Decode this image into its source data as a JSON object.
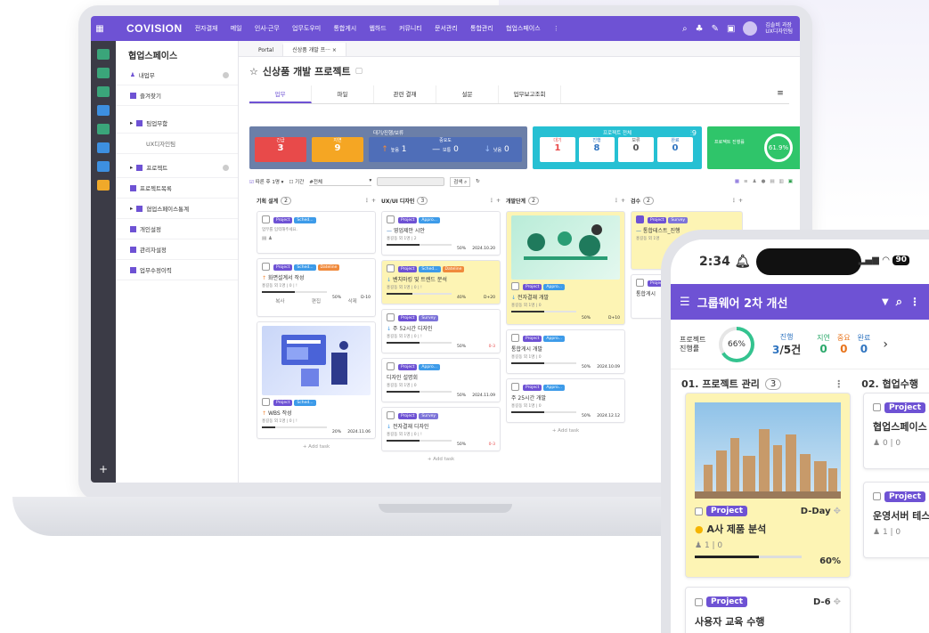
{
  "app": {
    "logo": "COVISION",
    "menu": [
      "전자결재",
      "메일",
      "인사·근무",
      "업무도우미",
      "통합게시",
      "웹하드",
      "커뮤니티",
      "문서관리",
      "통합관리",
      "협업스페이스"
    ],
    "more": "⋮",
    "user": "김솔비 과장",
    "dept": "UX디자인팀",
    "accent": "#6e52d4"
  },
  "side": {
    "title": "협업스페이스",
    "items": [
      {
        "label": "내업무"
      },
      {
        "label": "즐겨찾기"
      },
      {
        "label": "팀업무함"
      },
      {
        "label": "UX디자인팀"
      },
      {
        "label": "프로젝트"
      },
      {
        "label": "프로젝트목록"
      },
      {
        "label": "협업스페이스통계"
      },
      {
        "label": "개인설정"
      },
      {
        "label": "관리자설정"
      },
      {
        "label": "업무수정이력"
      }
    ]
  },
  "tabs": {
    "portal": "Portal",
    "active": "신상품 개발 프···",
    "close": "×"
  },
  "page": {
    "title": "신상품 개발 프로젝트",
    "star": "☆"
  },
  "vtabs": [
    "업무",
    "파일",
    "관련 결재",
    "설문",
    "업무보고조회"
  ],
  "status": {
    "group1_title": "대기/진행/보류",
    "urgent_label": "긴급",
    "urgent": "3",
    "delay_label": "지연",
    "delay": "9",
    "importance_label": "중요도",
    "high_label": "높음",
    "high": "1",
    "mid_label": "보통",
    "mid": "0",
    "low_label": "낮음",
    "low": "0",
    "group2_title": "프로젝트 전체",
    "group2_total": "9",
    "wait_label": "대기",
    "wait": "1",
    "prog_label": "진행",
    "prog": "8",
    "hold_label": "보류",
    "hold": "0",
    "done_label": "완료",
    "done": "0",
    "rate_label": "프로젝트 진행률",
    "rate": "61.9%"
  },
  "toolbar": {
    "mine": "따른 후 1명",
    "period": "기간",
    "all": "#전체",
    "search": "검색"
  },
  "columns": [
    {
      "title": "기획 설계",
      "count": "2",
      "cards": [
        {
          "tags": [
            "Project",
            "Sched..."
          ],
          "title": "",
          "placeholder": "업무를 입력해주세요."
        },
        {
          "tags": [
            "Project",
            "Sched...",
            "Dateline"
          ],
          "title": "화면설계서 작성",
          "meta": "홍길동 외 1명 | 0 | !",
          "pct": "50%",
          "date": "D-10",
          "count": "2",
          "actions": [
            "복사",
            "편집",
            "삭제"
          ]
        },
        {
          "tags": [
            "Project",
            "Sched..."
          ],
          "title": "WBS 작성",
          "meta": "홍길동 외 1명 | 0 | !",
          "pct": "20%",
          "date": "2024.11.06",
          "count": "1",
          "progress": 0.2
        }
      ]
    },
    {
      "title": "UX/UI 디자인",
      "count": "3",
      "cards": [
        {
          "tags": [
            "Project",
            "Appro..."
          ],
          "title": "영업제안 시안",
          "meta": "홍길동 외 1명 | 2",
          "pct": "50%",
          "date": "2024.10.20"
        },
        {
          "tags": [
            "Project",
            "Sched...",
            "Dateline"
          ],
          "title": "벤치마킹 및 트렌드 분석",
          "meta": "홍길동 외 1명 | 0 | !",
          "pct": "40%",
          "date": "D+20"
        },
        {
          "tags": [
            "Project",
            "Survey"
          ],
          "title": "주 52시간 디자인",
          "meta": "홍길동 외 1명 | 0 | !",
          "pct": "50%",
          "date": "0-3",
          "count": "1"
        },
        {
          "tags": [
            "Project",
            "Appro..."
          ],
          "title": "디자인 설명회",
          "meta": "홍길동 외 1명 | 0",
          "pct": "50%",
          "date": "2024.11.09",
          "count": "1"
        },
        {
          "tags": [
            "Project",
            "Survey"
          ],
          "title": "전자결재 디자인",
          "meta": "홍길동 외 1명 | 0 | !",
          "pct": "50%",
          "date": "0-3",
          "count": "1"
        }
      ]
    },
    {
      "title": "개발단계",
      "count": "2",
      "cards": [
        {
          "tags": [
            "Project",
            "Appro..."
          ],
          "title": "전자결재 개발",
          "meta": "홍길동 외 1명 | 0",
          "pct": "50%",
          "date": "D+10",
          "count": "2"
        },
        {
          "tags": [
            "Project",
            "Appro..."
          ],
          "title": "통합게시 개발",
          "meta": "홍길동 외 1명 | 0",
          "pct": "50%",
          "date": "2024.10.09",
          "count": "1"
        },
        {
          "tags": [
            "Project",
            "Appro..."
          ],
          "title": "주 25시간 개발",
          "meta": "홍길동 외 1명 | 0",
          "pct": "50%",
          "date": "2024.12.12",
          "count": "1"
        }
      ]
    },
    {
      "title": "검수",
      "count": "2",
      "cards": [
        {
          "tags": [
            "Project",
            "Survey"
          ],
          "title": "통합테스트_진행",
          "meta": "홍길동 외 1명"
        },
        {
          "tags": [
            "Project"
          ],
          "title": "통합게시",
          "meta": ""
        }
      ]
    }
  ],
  "add_task": "+ Add task",
  "phone": {
    "time": "2:34",
    "battery": "90",
    "title": "그룹웨어 2차 개선",
    "rate_label": "프로젝트 진행률",
    "rate": "66%",
    "prog_label": "진행",
    "prog": "3",
    "total": "/5건",
    "delay_label": "지연",
    "delay": "0",
    "imp_label": "중요",
    "imp": "0",
    "done_label": "완료",
    "done": "0",
    "sec1": "01. 프로젝트 관리",
    "sec1_count": "3",
    "sec2": "02. 협업수행",
    "card1": {
      "tag": "Project",
      "dday": "D-Day",
      "title": "A사 제품 분석",
      "meta": "1 | 0",
      "pct": "60%",
      "progress": 0.6
    },
    "card2": {
      "tag": "Project",
      "dday": "D-6",
      "title": "사용자 교육 수행"
    },
    "card3": {
      "tag": "Project",
      "title": "협업스페이스",
      "meta": "0 | 0"
    },
    "card4": {
      "tag": "Project",
      "title": "운영서버 테스",
      "meta": "1 | 0"
    }
  }
}
